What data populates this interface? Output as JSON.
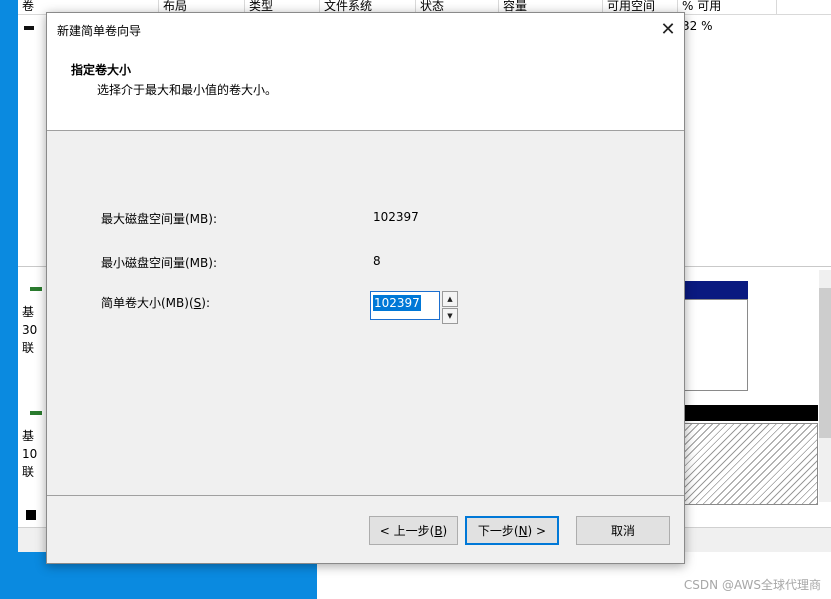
{
  "background_window": {
    "columns": [
      "卷",
      "布局",
      "类型",
      "文件系统",
      "状态",
      "容量",
      "可用空间",
      "% 可用"
    ],
    "free_percent": "32 %",
    "disks": [
      {
        "line1": "基",
        "line2": "30",
        "line3": "联"
      },
      {
        "line1": "基",
        "line2": "10",
        "line3": "联"
      }
    ]
  },
  "dialog": {
    "title": "新建简单卷向导",
    "close_symbol": "✕",
    "header_title": "指定卷大小",
    "header_subtitle": "选择介于最大和最小值的卷大小。",
    "max_label": "最大磁盘空间量(MB):",
    "max_value": "102397",
    "min_label": "最小磁盘空间量(MB):",
    "min_value": "8",
    "size_label_prefix": "简单卷大小(MB)(",
    "size_label_key": "S",
    "size_label_suffix": "):",
    "size_value": "102397",
    "back_prefix": "< 上一步(",
    "back_key": "B",
    "back_suffix": ")",
    "next_prefix": "下一步(",
    "next_key": "N",
    "next_suffix": ") >",
    "cancel_label": "取消"
  },
  "watermark": "CSDN @AWS全球代理商",
  "colors": {
    "desktop": "#0a8ae0",
    "selection": "#0078d7",
    "partition_bar": "#0a1a80"
  }
}
